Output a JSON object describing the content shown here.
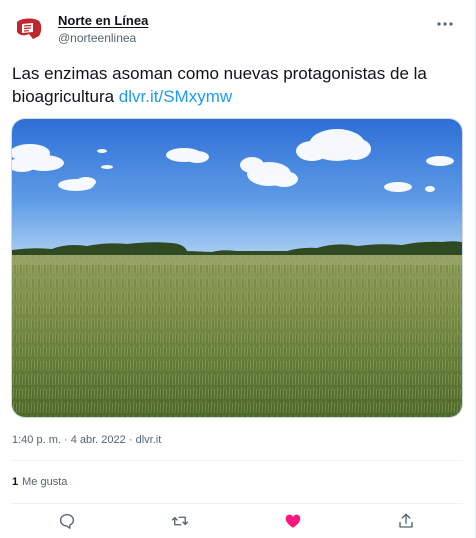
{
  "author": {
    "display_name": "Norte en Línea",
    "handle": "@norteenlinea"
  },
  "tweet": {
    "text": "Las enzimas asoman como nuevas protagonistas de la bioagricultura",
    "link": "dlvr.it/SMxymw"
  },
  "meta": {
    "time": "1:40 p. m.",
    "separator": "·",
    "date": "4 abr. 2022",
    "source": "dlvr.it"
  },
  "stats": {
    "likes_count": "1",
    "likes_label": "Me gusta"
  },
  "actions": {
    "reply": "reply-icon",
    "retweet": "retweet-icon",
    "like": "heart-icon",
    "share": "share-icon"
  },
  "colors": {
    "accent": "#1d9bf0",
    "like": "#f91880",
    "brand": "#c0272d"
  }
}
